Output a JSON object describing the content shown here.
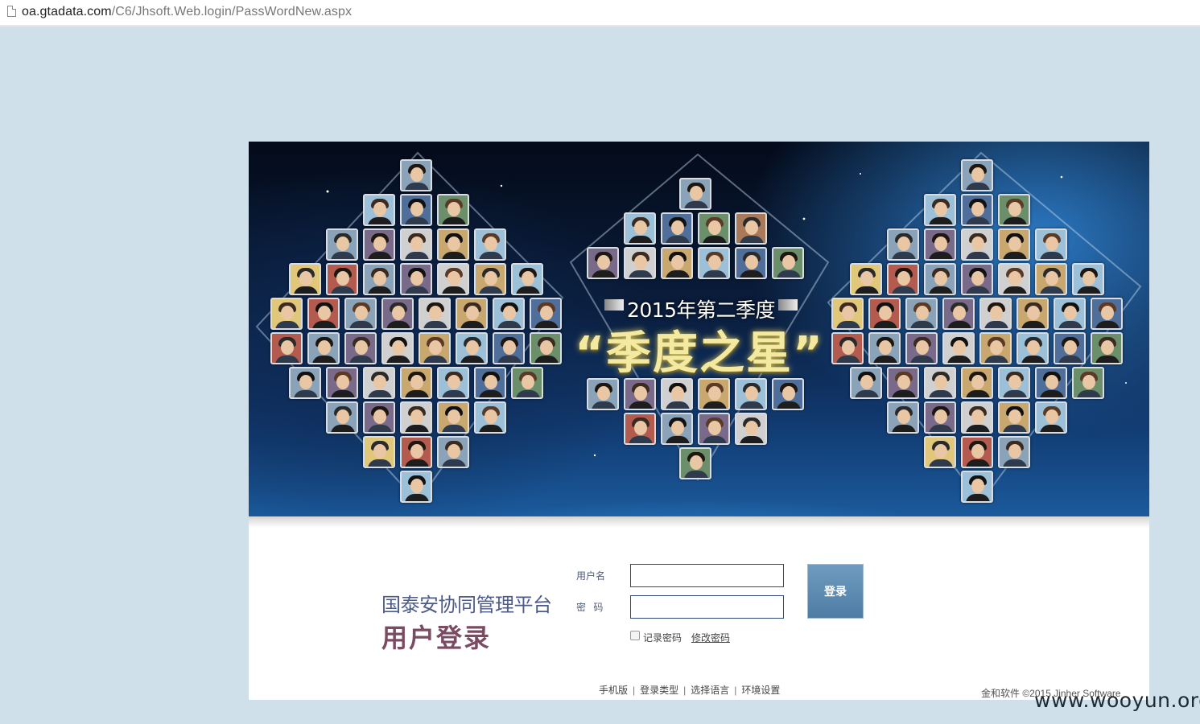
{
  "browser": {
    "url_host": "oa.gtadata.com",
    "url_path": "/C6/Jhsoft.Web.login/PassWordNew.aspx"
  },
  "banner": {
    "season": "2015年第二季度",
    "title": "“季度之星”"
  },
  "login": {
    "system_name": "国泰安协同管理平台",
    "title": "用户登录",
    "username_label": "用户名",
    "password_label": "密 码",
    "username_value": "",
    "password_value": "",
    "login_button": "登录",
    "remember_label": "记录密码",
    "remember_checked": false,
    "change_password": "修改密码"
  },
  "footer": {
    "links": [
      "手机版",
      "登录类型",
      "选择语言",
      "环境设置"
    ],
    "separator": "|",
    "copyright": "金和软件 ©2015 Jinher Software"
  },
  "watermark": "www.wooyun.org"
}
